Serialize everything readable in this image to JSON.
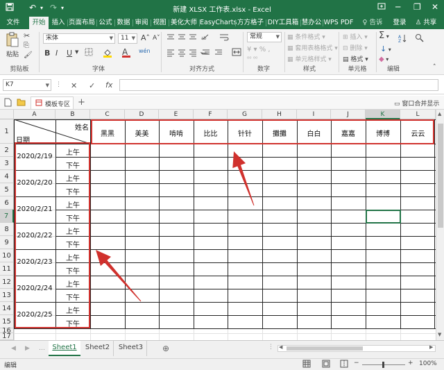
{
  "window": {
    "title": "新建 XLSX 工作表.xlsx - Excel",
    "save_icon": "save-icon",
    "undo_icon": "undo-icon",
    "redo_icon": "redo-icon",
    "minimize": "─",
    "restore": "❐",
    "close": "✕"
  },
  "ribbon_tabs": [
    "文件",
    "开始",
    "插入",
    "页面布局",
    "公式",
    "数据",
    "审阅",
    "视图",
    "美化大师",
    "EasyCharts",
    "方方格子",
    "DIY工具箱",
    "慧办公",
    "WPS PDF"
  ],
  "active_tab": "开始",
  "tell_me": "告诉我...",
  "login": "登录",
  "share": "共享",
  "ribbon": {
    "clipboard": {
      "paste": "粘贴",
      "label": "剪贴板"
    },
    "font": {
      "name": "宋体",
      "size": "11",
      "bold": "B",
      "italic": "I",
      "underline": "U",
      "grow": "A",
      "shrink": "A",
      "fill_icon": "fill-color-icon",
      "font_color": "A",
      "wen": "wén",
      "label": "字体"
    },
    "alignment": {
      "label": "对齐方式"
    },
    "number": {
      "format": "常规",
      "label": "数字"
    },
    "styles": {
      "cond": "条件格式",
      "table": "套用表格格式",
      "cell": "单元格样式",
      "label": "样式"
    },
    "cells": {
      "insert": "插入",
      "delete": "删除",
      "format": "格式",
      "label": "单元格"
    },
    "editing": {
      "sum": "Σ",
      "fill": "↓",
      "clear": "◆",
      "label": "编辑"
    }
  },
  "formula_bar": {
    "name_box": "K7",
    "cancel": "✕",
    "enter": "✓",
    "fx": "fx",
    "value": ""
  },
  "tab_strip": {
    "template_center": "模板专区",
    "add": "+",
    "merge_window": "窗口合并显示"
  },
  "grid": {
    "columns": [
      "A",
      "B",
      "C",
      "D",
      "E",
      "F",
      "G",
      "H",
      "I",
      "J",
      "K",
      "L"
    ],
    "selected_column": "K",
    "rows": [
      "1",
      "2",
      "3",
      "4",
      "5",
      "6",
      "7",
      "8",
      "9",
      "10",
      "11",
      "12",
      "13",
      "14",
      "15",
      "16",
      "17"
    ],
    "selected_row": "7",
    "header_diag": {
      "top_right": "姓名",
      "bottom_left": "日期"
    },
    "names": [
      "黑黑",
      "美美",
      "啃啃",
      "比比",
      "针针",
      "攤攤",
      "白白",
      "嘉嘉",
      "博博",
      "云云"
    ],
    "dates": [
      "2020/2/19",
      "2020/2/20",
      "2020/2/21",
      "2020/2/22",
      "2020/2/23",
      "2020/2/24",
      "2020/2/25"
    ],
    "am": "上午",
    "pm": "下午",
    "active_cell": "K7"
  },
  "sheets": [
    "Sheet1",
    "Sheet2",
    "Sheet3"
  ],
  "active_sheet": "Sheet1",
  "add_sheet": "⊕",
  "status": {
    "mode": "编辑",
    "zoom": "100%",
    "zoom_minus": "−",
    "zoom_plus": "+"
  },
  "colors": {
    "excel_green": "#217346",
    "annotation_red": "#d0312d"
  }
}
